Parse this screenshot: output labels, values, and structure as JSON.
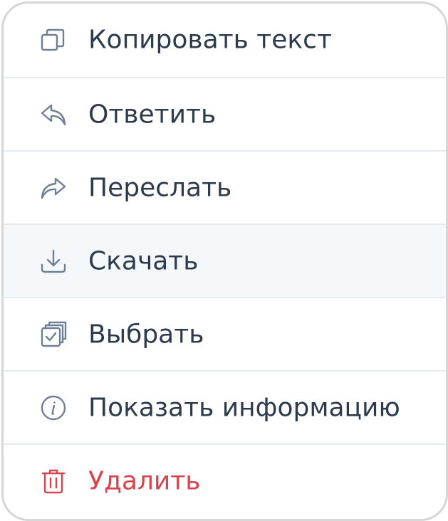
{
  "menu": {
    "items": [
      {
        "label": "Копировать текст",
        "icon": "copy-icon"
      },
      {
        "label": "Ответить",
        "icon": "reply-icon"
      },
      {
        "label": "Переслать",
        "icon": "forward-icon"
      },
      {
        "label": "Скачать",
        "icon": "download-icon"
      },
      {
        "label": "Выбрать",
        "icon": "select-icon"
      },
      {
        "label": "Показать информацию",
        "icon": "info-icon"
      },
      {
        "label": "Удалить",
        "icon": "trash-icon"
      }
    ]
  },
  "colors": {
    "text": "#2b3a4d",
    "icon": "#6e8096",
    "danger": "#d9434b",
    "hover": "#f5f8fb",
    "separator": "#e6ebf0",
    "border": "#d6d6d6"
  }
}
